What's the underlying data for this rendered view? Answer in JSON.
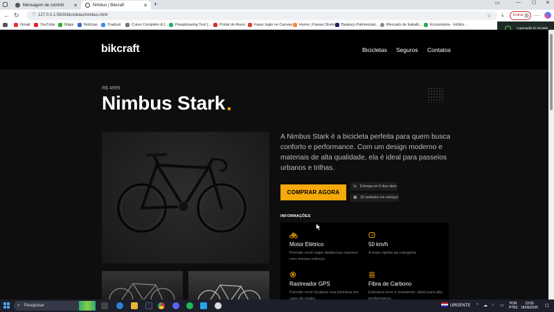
{
  "browser": {
    "tabs": [
      {
        "title": "Mensagem de commit",
        "active": false
      },
      {
        "title": "Nimbus | Bikcraft",
        "active": true
      }
    ],
    "new_tab": "+",
    "url": "127.0.0.1:5500/bicicletas/nimbus.html",
    "signin_label": "Entrar",
    "bookmarks": [
      "Gmail",
      "YouTube",
      "Maps",
      "Notícias",
      "Traduzir",
      "Curso Completo di l...",
      "Paraphrasing Tool |...",
      "Portal do Aluno",
      "Fazer login no Canvas",
      "Home | Passei Direto",
      "Balanço Patrimonial...",
      "Mercado de trabalh...",
      "Economista - InfoEs..."
    ],
    "recording_text": "A gravação foi iniciada"
  },
  "site": {
    "logo": "bikcraft",
    "nav": [
      "Bicicletas",
      "Seguros",
      "Contatos"
    ],
    "price": "R$ 4999",
    "title": "Nimbus Stark",
    "title_dot": ".",
    "description": "A Nimbus Stark é a bicicleta perfeita para quem busca conforto e performance. Com um design moderno e materiais de alta qualidade, ela é ideal para passeios urbanos e trilhas.",
    "buy_button": "COMPRAR AGORA",
    "delivery": "Entrega em 5 dias úteis",
    "stock": "18 unidades em estoque",
    "info_heading": "INFORMAÇÕES",
    "features": [
      {
        "icon": "bike-icon",
        "name": "Motor Elétrico",
        "desc": "Permite você viajar distâncias maiores com menos esforço."
      },
      {
        "icon": "speedometer-icon",
        "name": "50 km/h",
        "desc": "A mais rápida da categoria."
      },
      {
        "icon": "gps-icon",
        "name": "Rastreador GPS",
        "desc": "Permite você localizar sua bicicleta em caso de roubo."
      },
      {
        "icon": "carbon-icon",
        "name": "Fibra de Carbono",
        "desc": "Estrutura leve e resistente, ideal para alta performance."
      }
    ],
    "accent_color": "#f5a90a"
  },
  "taskbar": {
    "search_placeholder": "Pesquisar",
    "alert": "URGENTE",
    "lang_line1": "POR",
    "lang_line2": "PTB2",
    "time": "19:55",
    "date": "18/06/2025"
  }
}
